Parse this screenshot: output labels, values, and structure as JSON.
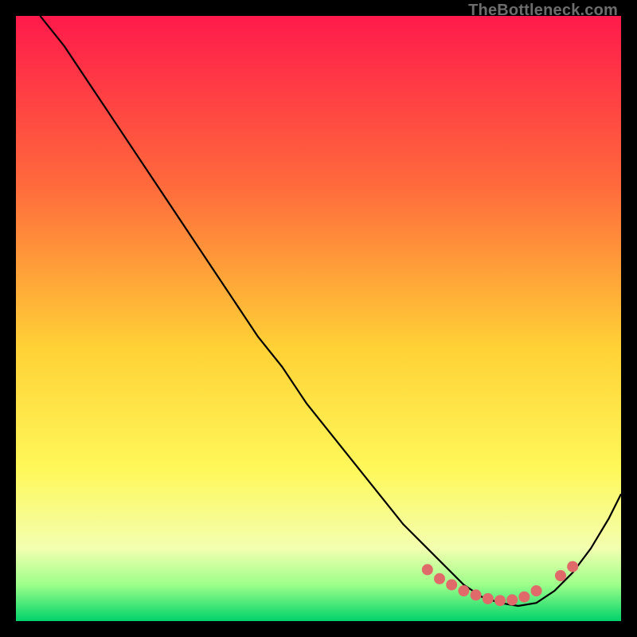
{
  "watermark": "TheBottleneck.com",
  "colors": {
    "bg": "#000000",
    "grad_top": "#ff1a4b",
    "grad_mid1": "#ff6a3c",
    "grad_mid2": "#ffd236",
    "grad_mid3": "#fff85a",
    "grad_bottom1": "#f3ffb0",
    "grad_bottom2": "#9cff8a",
    "grad_bottom3": "#00d36a",
    "curve": "#000000",
    "dots": "#e06a6a"
  },
  "chart_data": {
    "type": "line",
    "title": "",
    "xlabel": "",
    "ylabel": "",
    "xlim": [
      0,
      100
    ],
    "ylim": [
      0,
      100
    ],
    "series": [
      {
        "name": "bottleneck-curve",
        "x": [
          4,
          8,
          12,
          16,
          20,
          24,
          28,
          32,
          36,
          40,
          44,
          48,
          52,
          56,
          60,
          64,
          68,
          71,
          74,
          77,
          80,
          83,
          86,
          89,
          92,
          95,
          98,
          100
        ],
        "y": [
          100,
          95,
          89,
          83,
          77,
          71,
          65,
          59,
          53,
          47,
          42,
          36,
          31,
          26,
          21,
          16,
          12,
          9,
          6,
          4,
          3,
          2.5,
          3,
          5,
          8,
          12,
          17,
          21
        ]
      }
    ],
    "highlight_dots": {
      "name": "optimal-range",
      "x": [
        68,
        70,
        72,
        74,
        76,
        78,
        80,
        82,
        84,
        86,
        90,
        92
      ],
      "y": [
        8.5,
        7,
        6,
        5,
        4.3,
        3.7,
        3.4,
        3.5,
        4,
        5,
        7.5,
        9
      ]
    },
    "gradient_bands_pct": [
      {
        "stop": 0,
        "color": "#ff1a4b"
      },
      {
        "stop": 28,
        "color": "#ff6a3c"
      },
      {
        "stop": 55,
        "color": "#ffd236"
      },
      {
        "stop": 75,
        "color": "#fff85a"
      },
      {
        "stop": 88,
        "color": "#f3ffb0"
      },
      {
        "stop": 94,
        "color": "#9cff8a"
      },
      {
        "stop": 100,
        "color": "#00d36a"
      }
    ]
  }
}
